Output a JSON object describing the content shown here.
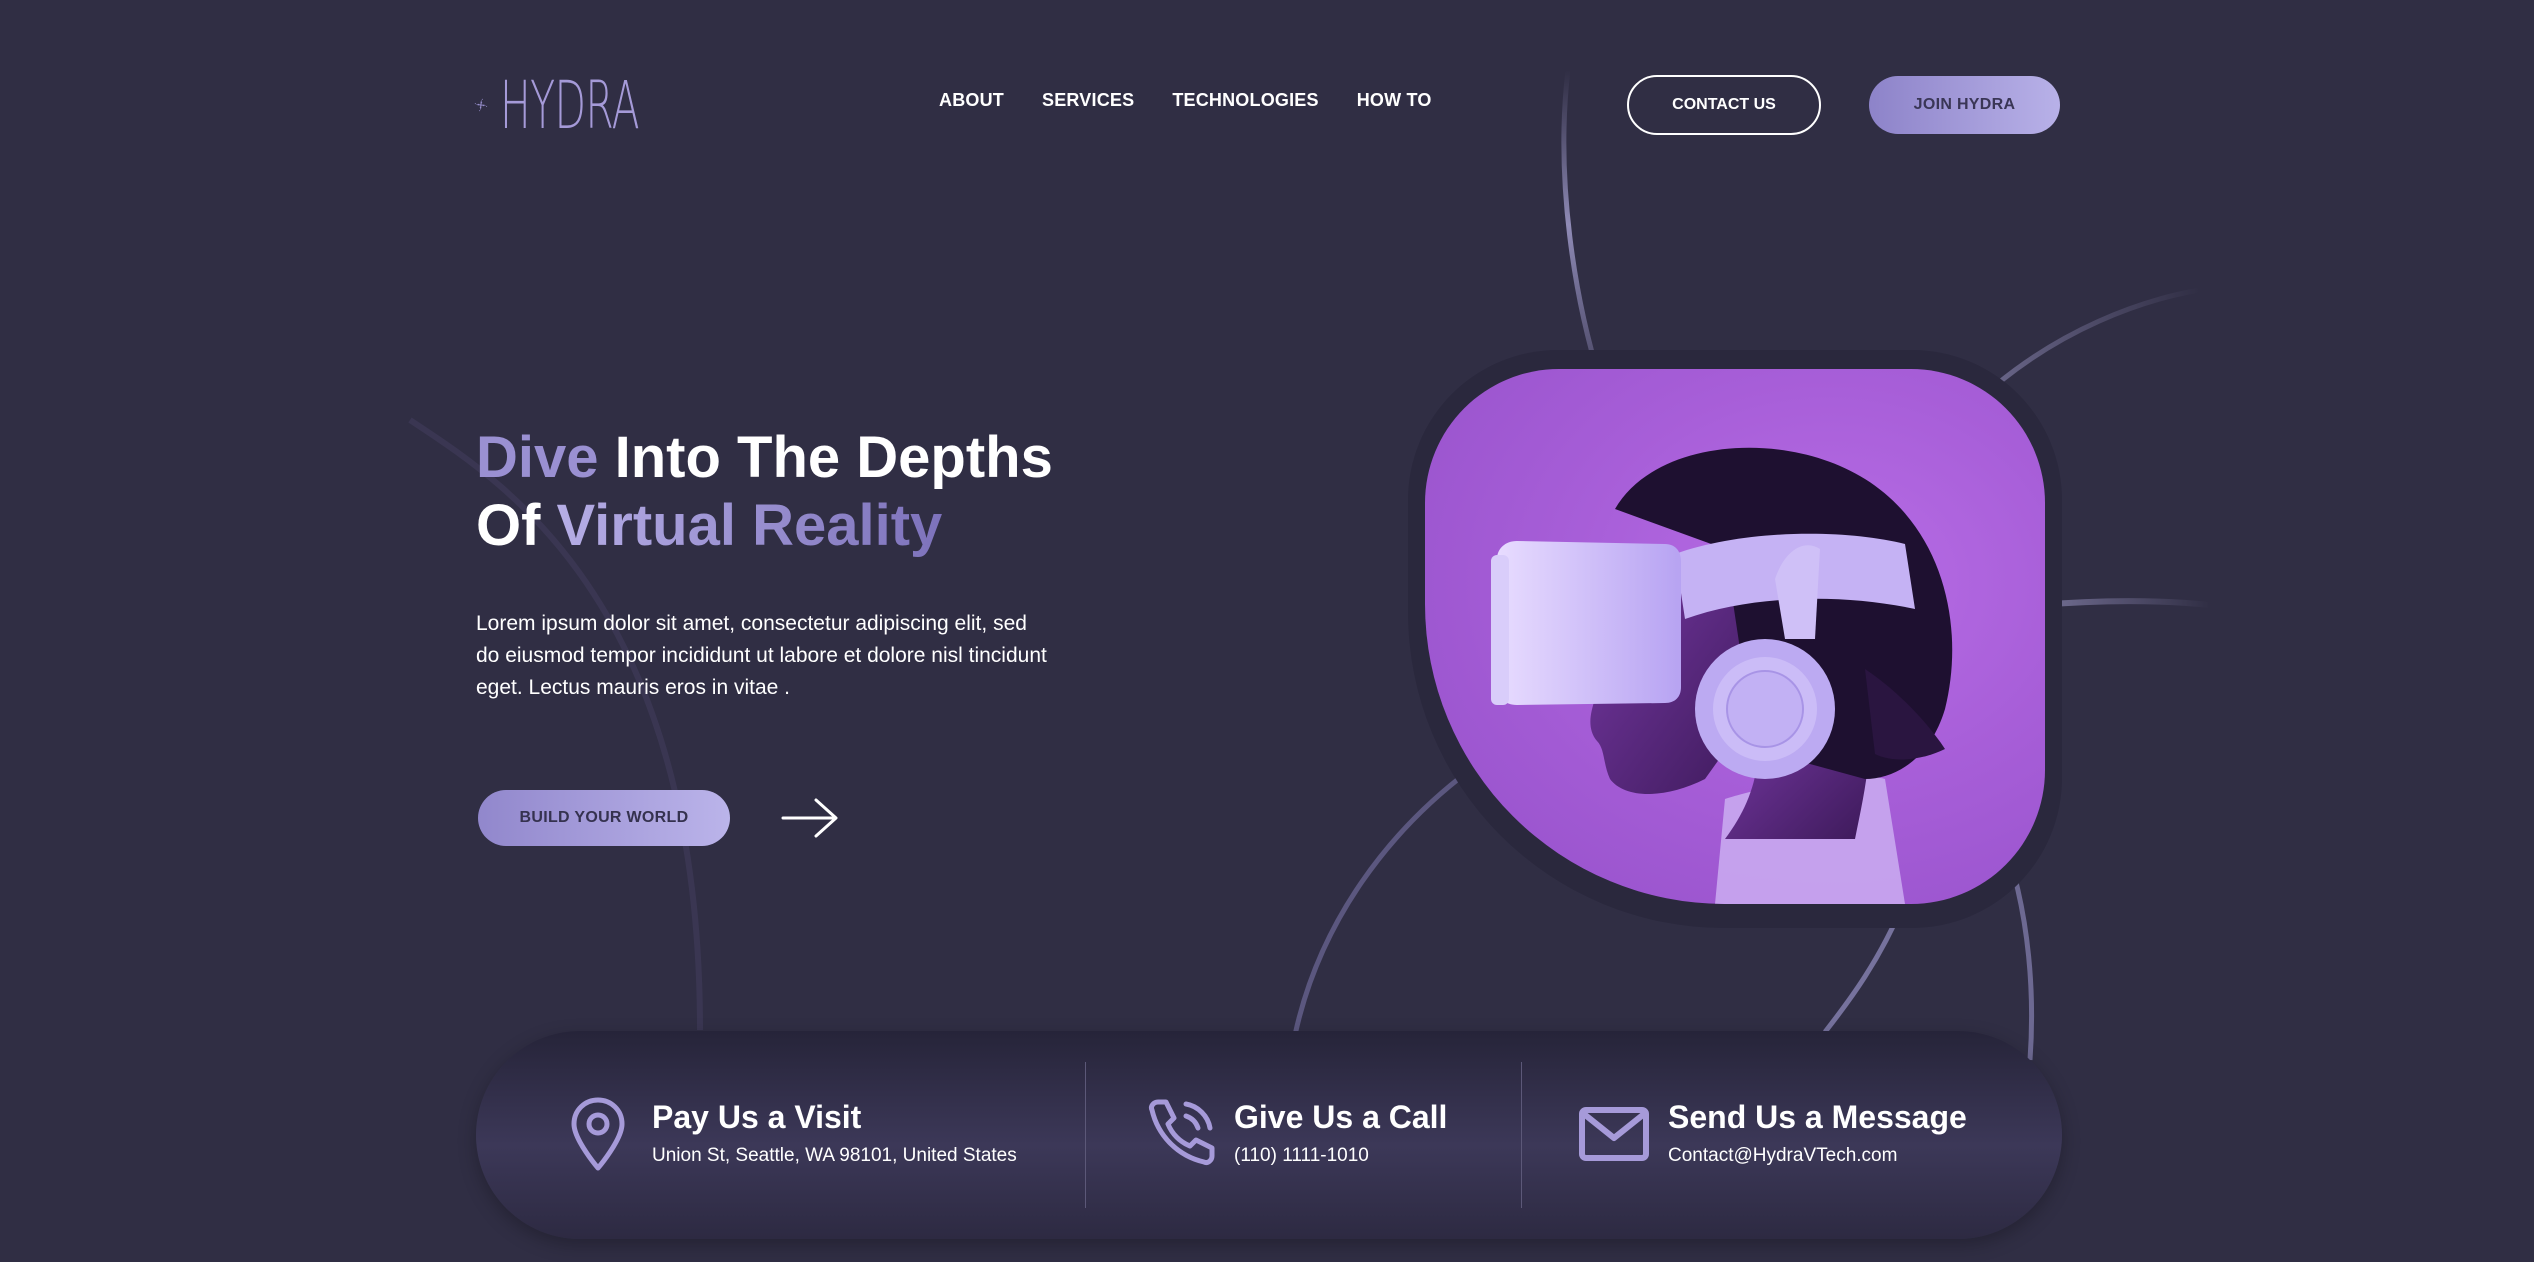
{
  "brand": {
    "name": "HYDRA",
    "logo_icon": "hydra-swirl-icon",
    "accent": "#9a90d2",
    "background": "#302e44"
  },
  "nav": {
    "items": [
      "ABOUT",
      "SERVICES",
      "TECHNOLOGIES",
      "HOW TO"
    ]
  },
  "header": {
    "contact_label": "CONTACT US",
    "join_label": "JOIN HYDRA"
  },
  "hero": {
    "title_part1": "Dive",
    "title_part2": " Into The Depths",
    "title_part3": "Of ",
    "title_part4": "Virtual Reality",
    "text": "Lorem ipsum dolor sit amet, consectetur adipiscing elit, sed do eiusmod tempor incididunt ut labore et dolore nisl tincidunt eget. Lectus mauris eros in vitae .",
    "cta_label": "BUILD YOUR WORLD",
    "cta_arrow_icon": "arrow-right-icon",
    "image_subject": "person-wearing-vr-headset"
  },
  "contact": {
    "items": [
      {
        "icon": "map-pin-icon",
        "title": "Pay Us a Visit",
        "detail": "Union St, Seattle, WA 98101, United States"
      },
      {
        "icon": "phone-icon",
        "title": "Give Us a Call",
        "detail": "(110) 1111-1010"
      },
      {
        "icon": "envelope-icon",
        "title": "Send Us a Message",
        "detail": "Contact@HydraVTech.com"
      }
    ]
  }
}
